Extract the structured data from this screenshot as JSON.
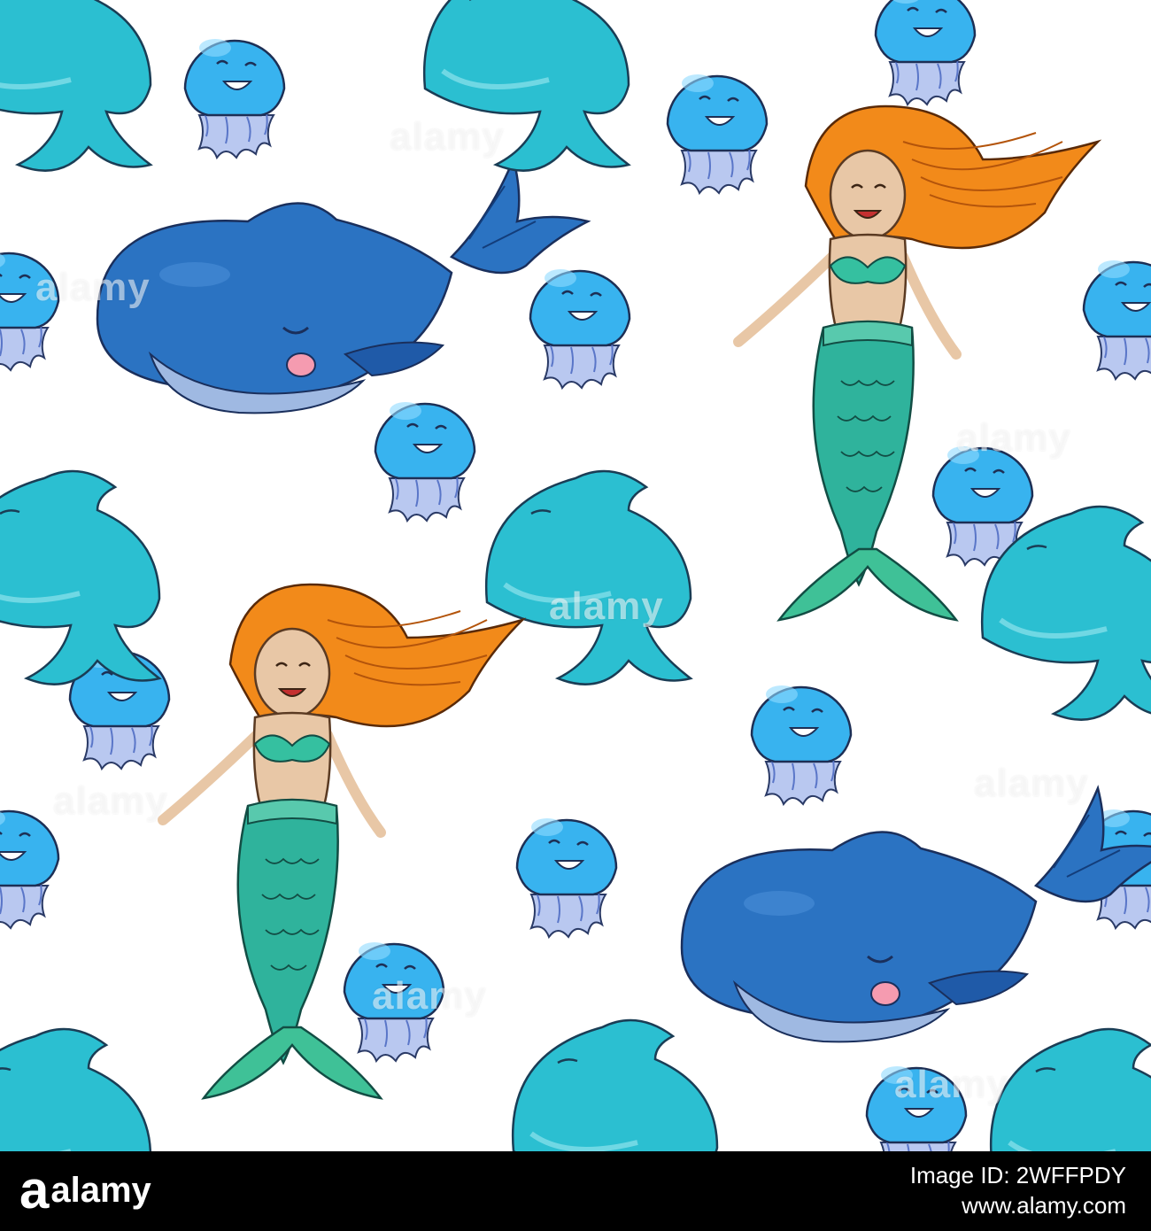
{
  "image": {
    "background_color": "#ffffff",
    "subject": "seamless sea-life pattern with mermaids, whales, dolphins and jellyfish",
    "colors": {
      "jellyfish_bell": "#38b3ef",
      "jellyfish_tentacles": "#b9c8f0",
      "whale_body": "#2b73c2",
      "whale_belly": "#9fb9e2",
      "dolphin_body": "#2bbfd1",
      "mermaid_hair": "#f28a1a",
      "mermaid_tail": "#2fb39c",
      "mermaid_skin": "#e8c7a6",
      "whale_tongue": "#f59bb0"
    }
  },
  "watermark": {
    "text": "alamy"
  },
  "footer": {
    "logo": "a",
    "brand": "alamy",
    "image_id_label": "Image ID: 2WFFPDY",
    "site": "www.alamy.com"
  }
}
